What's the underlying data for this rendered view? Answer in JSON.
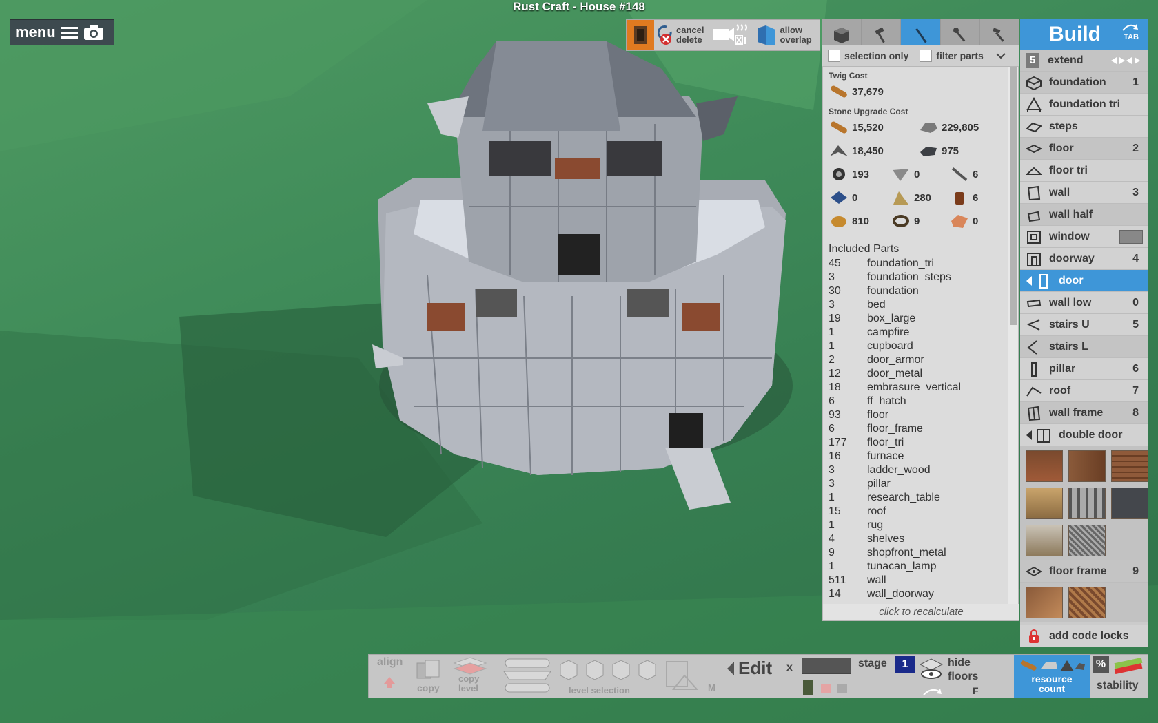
{
  "window": {
    "title": "Rust Craft - House #148"
  },
  "menu": {
    "label": "menu"
  },
  "toolbar": {
    "cancel_delete": [
      "cancel",
      "delete"
    ],
    "allow_overlap": [
      "allow",
      "overlap"
    ]
  },
  "filters": {
    "selection_only": "selection only",
    "filter_parts": "filter parts"
  },
  "costs": {
    "twig_title": "Twig Cost",
    "twig_value": "37,679",
    "stone_title": "Stone Upgrade Cost",
    "resources": [
      {
        "icon": "wood-icon",
        "value": "15,520"
      },
      {
        "icon": "stone-icon",
        "value": "229,805"
      },
      {
        "icon": "metal-fragments-icon",
        "value": "18,450"
      },
      {
        "icon": "hq-metal-icon",
        "value": "975"
      },
      {
        "icon": "gears-icon",
        "value": "193"
      },
      {
        "icon": "metal-blade-icon",
        "value": "0"
      },
      {
        "icon": "metal-pipe-icon",
        "value": "6"
      },
      {
        "icon": "tarp-icon",
        "value": "0"
      },
      {
        "icon": "cloth-icon",
        "value": "280"
      },
      {
        "icon": "lowgrade-fuel-icon",
        "value": "6"
      },
      {
        "icon": "leather-icon",
        "value": "810"
      },
      {
        "icon": "rope-icon",
        "value": "9"
      },
      {
        "icon": "sheet-metal-icon",
        "value": "0"
      }
    ]
  },
  "included_parts": {
    "title": "Included Parts",
    "items": [
      {
        "count": "45",
        "name": "foundation_tri"
      },
      {
        "count": "3",
        "name": "foundation_steps"
      },
      {
        "count": "30",
        "name": "foundation"
      },
      {
        "count": "3",
        "name": "bed"
      },
      {
        "count": "19",
        "name": "box_large"
      },
      {
        "count": "1",
        "name": "campfire"
      },
      {
        "count": "1",
        "name": "cupboard"
      },
      {
        "count": "2",
        "name": "door_armor"
      },
      {
        "count": "12",
        "name": "door_metal"
      },
      {
        "count": "18",
        "name": "embrasure_vertical"
      },
      {
        "count": "6",
        "name": "ff_hatch"
      },
      {
        "count": "93",
        "name": "floor"
      },
      {
        "count": "6",
        "name": "floor_frame"
      },
      {
        "count": "177",
        "name": "floor_tri"
      },
      {
        "count": "16",
        "name": "furnace"
      },
      {
        "count": "3",
        "name": "ladder_wood"
      },
      {
        "count": "3",
        "name": "pillar"
      },
      {
        "count": "1",
        "name": "research_table"
      },
      {
        "count": "15",
        "name": "roof"
      },
      {
        "count": "1",
        "name": "rug"
      },
      {
        "count": "4",
        "name": "shelves"
      },
      {
        "count": "9",
        "name": "shopfront_metal"
      },
      {
        "count": "1",
        "name": "tunacan_lamp"
      },
      {
        "count": "511",
        "name": "wall"
      },
      {
        "count": "14",
        "name": "wall_doorway"
      }
    ],
    "recalc": "click to recalculate"
  },
  "build": {
    "title": "Build",
    "tab_key": "TAB",
    "extend_count": "5",
    "extend_label": "extend",
    "items": [
      {
        "label": "foundation",
        "num": "1",
        "icon": "foundation-icon"
      },
      {
        "label": "foundation tri",
        "num": "",
        "icon": "foundation-tri-icon"
      },
      {
        "label": "steps",
        "num": "",
        "icon": "steps-icon"
      },
      {
        "label": "floor",
        "num": "2",
        "icon": "floor-icon"
      },
      {
        "label": "floor tri",
        "num": "",
        "icon": "floor-tri-icon"
      },
      {
        "label": "wall",
        "num": "3",
        "icon": "wall-icon"
      },
      {
        "label": "wall half",
        "num": "",
        "icon": "wall-half-icon"
      },
      {
        "label": "window",
        "num": "",
        "icon": "window-icon"
      },
      {
        "label": "doorway",
        "num": "4",
        "icon": "doorway-icon"
      },
      {
        "label": "door",
        "num": "",
        "icon": "door-icon"
      },
      {
        "label": "wall low",
        "num": "0",
        "icon": "wall-low-icon"
      },
      {
        "label": "stairs U",
        "num": "5",
        "icon": "stairs-u-icon"
      },
      {
        "label": "stairs L",
        "num": "",
        "icon": "stairs-l-icon"
      },
      {
        "label": "pillar",
        "num": "6",
        "icon": "pillar-icon"
      },
      {
        "label": "roof",
        "num": "7",
        "icon": "roof-icon"
      },
      {
        "label": "wall frame",
        "num": "8",
        "icon": "wall-frame-icon"
      },
      {
        "label": "double door",
        "num": "",
        "icon": "double-door-icon"
      }
    ],
    "floor_frame_label": "floor frame",
    "floor_frame_num": "9",
    "code_locks": "add code locks"
  },
  "bottom": {
    "align": "align",
    "copy": "copy",
    "copy_level": [
      "copy",
      "level"
    ],
    "level_selection": "level selection",
    "m_key": "M",
    "edit": "Edit",
    "edit_close": "x",
    "stage_label": "stage",
    "stage_value": "1",
    "hide_floors": [
      "hide",
      "floors"
    ],
    "f_key": "F",
    "resource_count": [
      "resource",
      "count"
    ],
    "percent": "%",
    "stability": "stability"
  },
  "colors": {
    "accent": "#3e96d8",
    "panel": "#cbcbcb",
    "grass": "#3f8b59"
  }
}
